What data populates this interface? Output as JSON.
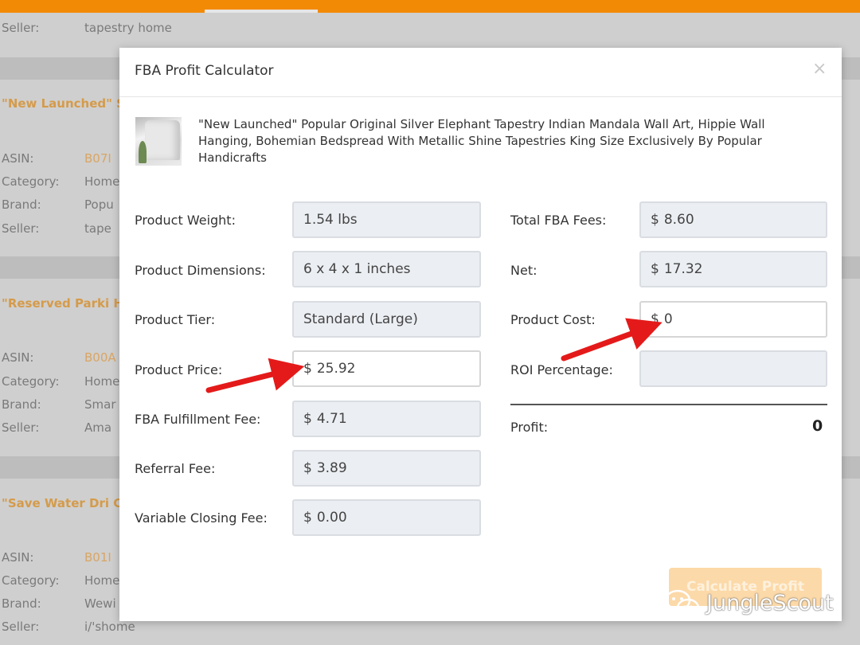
{
  "background": {
    "seller_top": {
      "key": "Seller:",
      "value": "tapestry home"
    },
    "items": [
      {
        "title": "\"New Launched\" Silver Elephant T",
        "rows": [
          {
            "key": "ASIN:",
            "value": "B07I"
          },
          {
            "key": "Category:",
            "value": "Home"
          },
          {
            "key": "Brand:",
            "value": "Popu"
          },
          {
            "key": "Seller:",
            "value": "tape"
          }
        ]
      },
      {
        "title": "\"Reserved Parki Handicap Parkin",
        "rows": [
          {
            "key": "ASIN:",
            "value": "B00A"
          },
          {
            "key": "Category:",
            "value": "Home"
          },
          {
            "key": "Brand:",
            "value": "Smar"
          },
          {
            "key": "Seller:",
            "value": "Ama"
          }
        ]
      },
      {
        "title": "\"Save Water Dri Cap Holder Sha",
        "rows": [
          {
            "key": "ASIN:",
            "value": "B01I"
          },
          {
            "key": "Category:",
            "value": "Home"
          },
          {
            "key": "Brand:",
            "value": "Wewi"
          },
          {
            "key": "Seller:",
            "value": "i/'shome"
          }
        ]
      }
    ]
  },
  "modal": {
    "title": "FBA Profit Calculator",
    "close_icon": "×",
    "product_name": "\"New Launched\" Popular Original Silver Elephant Tapestry Indian Mandala Wall Art, Hippie Wall Hanging, Bohemian Bedspread With Metallic Shine Tapestries King Size Exclusively By Popular Handicrafts",
    "left_fields": [
      {
        "label": "Product Weight:",
        "value": "1.54 lbs"
      },
      {
        "label": "Product Dimensions:",
        "value": "6 x 4 x 1 inches"
      },
      {
        "label": "Product Tier:",
        "value": "Standard (Large)"
      },
      {
        "label": "Product Price:",
        "currency": "$",
        "value": "25.92"
      },
      {
        "label": "FBA Fulfillment Fee:",
        "currency": "$",
        "value": "4.71"
      },
      {
        "label": "Referral Fee:",
        "currency": "$",
        "value": "3.89"
      },
      {
        "label": "Variable Closing Fee:",
        "currency": "$",
        "value": "0.00"
      }
    ],
    "right_fields": [
      {
        "label": "Total FBA Fees:",
        "currency": "$",
        "value": "8.60"
      },
      {
        "label": "Net:",
        "currency": "$",
        "value": "17.32"
      },
      {
        "label": "Product Cost:",
        "currency": "$",
        "value": "0"
      },
      {
        "label": "ROI Percentage:",
        "value": ""
      }
    ],
    "profit": {
      "label": "Profit:",
      "value": "0"
    },
    "calculate_button": "Calculate Profit"
  },
  "watermark": {
    "text": "JungleScout",
    "icon": "wechat-icon"
  },
  "colors": {
    "topbar": "#f38a05",
    "arrow": "#e41a1a",
    "button_disabled": "#fcd9a8"
  }
}
